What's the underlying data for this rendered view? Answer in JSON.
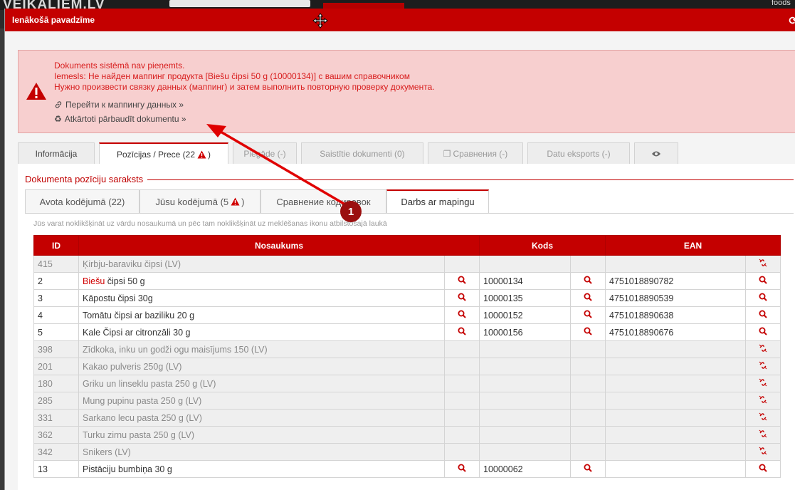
{
  "background": {
    "logo": "VEIKALIEM.LV",
    "user": "foods"
  },
  "modal": {
    "title": "Ienākošā pavadzīme"
  },
  "alert": {
    "line1": "Dokuments sistēmā nav pieņemts.",
    "line2": "Iemesls: Не найден маппинг продукта [Biešu čipsi 50 g (10000134)] с вашим справочником",
    "line3": "Нужно произвести связку данных (маппинг) и затем выполнить повторную проверку документа.",
    "link1": "Перейти к маппингу данных »",
    "link2": "Atkārtoti pārbaudīt dokumentu »"
  },
  "tabs": [
    {
      "label": "Informācija"
    },
    {
      "label": "Pozīcijas / Prece (22",
      "suffix": ")"
    },
    {
      "label": "Piegāde (-)"
    },
    {
      "label": "Saistītie dokumenti (0)"
    },
    {
      "label": "Сравнения (-)"
    },
    {
      "label": "Datu eksports (-)"
    }
  ],
  "section": {
    "legend": "Dokumenta pozīciju saraksts"
  },
  "subtabs": [
    {
      "label": "Avota kodējumā (22)"
    },
    {
      "label": "Jūsu kodējumā (5",
      "suffix": ")"
    },
    {
      "label": "Сравнение кодировок"
    },
    {
      "label": "Darbs ar mapingu"
    }
  ],
  "hint": "Jūs varat noklikšķināt uz vārdu nosaukumā un pēc tam noklikšķināt uz meklēšanas ikonu atbilstošajā laukā",
  "table": {
    "headers": {
      "id": "ID",
      "name": "Nosaukums",
      "code": "Kods",
      "ean": "EAN"
    },
    "rows": [
      {
        "id": "415",
        "name": "Ķirbju-baraviku čipsi (LV)",
        "code": "",
        "ean": "",
        "mapped": false
      },
      {
        "id": "2",
        "name_red": "Biešu",
        "name": " čipsi 50 g",
        "code": "10000134",
        "ean": "4751018890782",
        "mapped": true
      },
      {
        "id": "3",
        "name": "Kāpostu čipsi 30g",
        "code": "10000135",
        "ean": "4751018890539",
        "mapped": true
      },
      {
        "id": "4",
        "name": "Tomātu čipsi ar baziliku 20 g",
        "code": "10000152",
        "ean": "4751018890638",
        "mapped": true
      },
      {
        "id": "5",
        "name": "Kale Čipsi ar citronzāli 30 g",
        "code": "10000156",
        "ean": "4751018890676",
        "mapped": true
      },
      {
        "id": "398",
        "name": "Zīdkoka, inku un godži ogu maisījums 150 (LV)",
        "code": "",
        "ean": "",
        "mapped": false
      },
      {
        "id": "201",
        "name": "Kakao pulveris 250g (LV)",
        "code": "",
        "ean": "",
        "mapped": false
      },
      {
        "id": "180",
        "name": "Griku un linseklu pasta 250 g (LV)",
        "code": "",
        "ean": "",
        "mapped": false
      },
      {
        "id": "285",
        "name": "Mung pupinu pasta 250 g (LV)",
        "code": "",
        "ean": "",
        "mapped": false
      },
      {
        "id": "331",
        "name": "Sarkano lecu pasta 250 g (LV)",
        "code": "",
        "ean": "",
        "mapped": false
      },
      {
        "id": "362",
        "name": "Turku zirnu pasta 250 g (LV)",
        "code": "",
        "ean": "",
        "mapped": false
      },
      {
        "id": "342",
        "name": "Snikers (LV)",
        "code": "",
        "ean": "",
        "mapped": false
      },
      {
        "id": "13",
        "name": "Pistāciju bumbiņa 30 g",
        "code": "10000062",
        "ean": "",
        "mapped": true
      }
    ]
  },
  "annotation": {
    "badge": "1"
  },
  "colors": {
    "brand_red": "#c40000",
    "alert_bg": "#f7cfcf",
    "alert_text": "#d81d1d"
  }
}
